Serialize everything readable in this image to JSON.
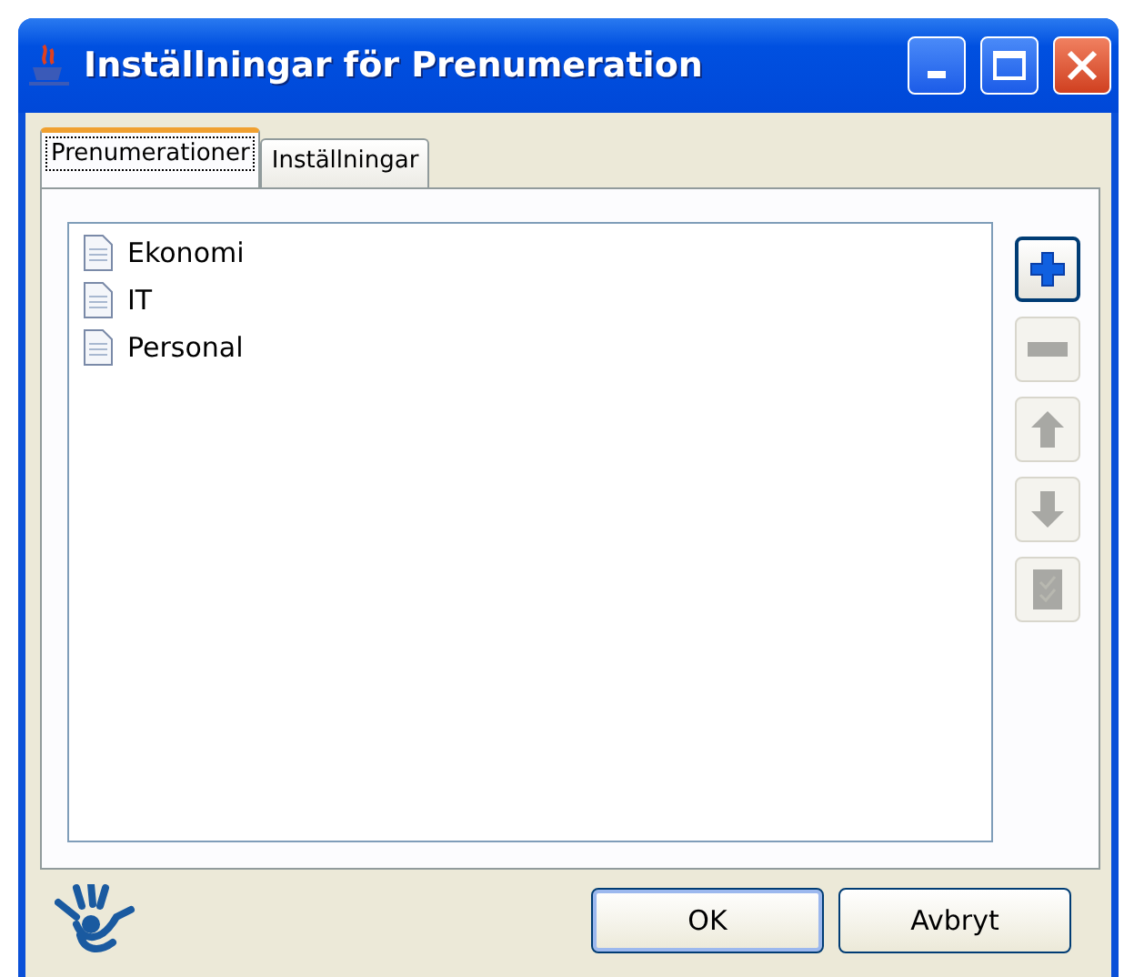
{
  "window": {
    "title": "Inställningar för Prenumeration"
  },
  "tabs": [
    {
      "label": "Prenumerationer",
      "selected": true
    },
    {
      "label": "Inställningar",
      "selected": false
    }
  ],
  "list": {
    "items": [
      {
        "label": "Ekonomi",
        "selected": false
      },
      {
        "label": "IT",
        "selected": false
      },
      {
        "label": "Personal",
        "selected": false
      }
    ]
  },
  "tools": [
    {
      "kind": "add",
      "disabled": false
    },
    {
      "kind": "remove",
      "disabled": true
    },
    {
      "kind": "up",
      "disabled": true
    },
    {
      "kind": "down",
      "disabled": true
    },
    {
      "kind": "check",
      "disabled": true
    }
  ],
  "buttons": [
    {
      "label": "OK",
      "default": true
    },
    {
      "label": "Avbryt",
      "default": false
    }
  ]
}
